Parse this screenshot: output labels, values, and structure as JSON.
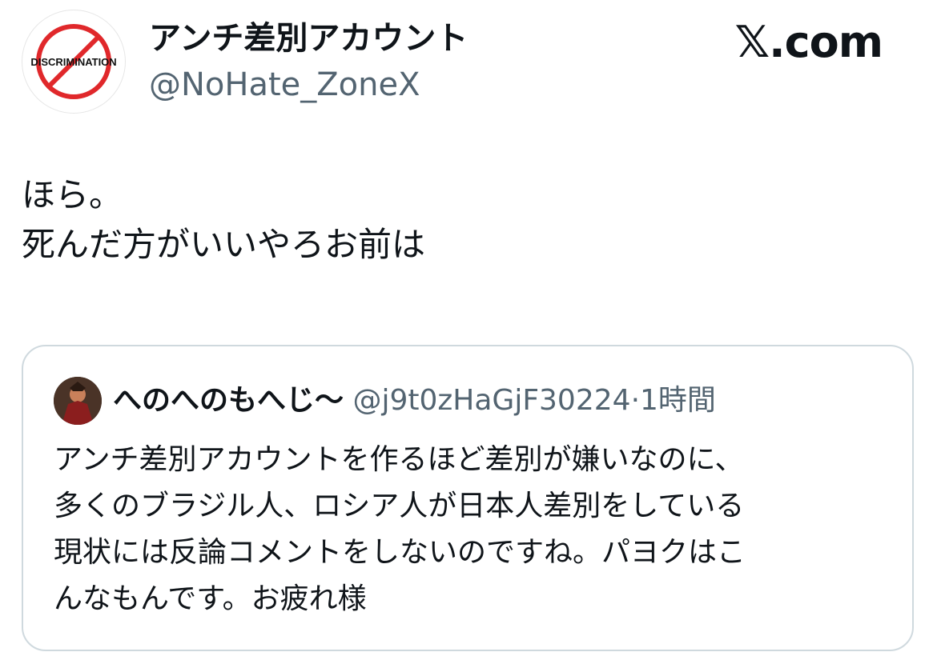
{
  "colors": {
    "text_primary": "#0f1419",
    "text_secondary": "#536471",
    "border": "#cfd9de",
    "avatar_prohibition_red": "#e0282b"
  },
  "author": {
    "avatar_icon": "discrimination-prohibited-avatar",
    "avatar_text": "DISCRIMINATION",
    "display_name": "アンチ差別アカウント",
    "handle": "@NoHate_ZoneX"
  },
  "brand": {
    "logo_icon": "x-logo-icon",
    "logo_glyph": "𝕏",
    "domain_text": ".com"
  },
  "tweet": {
    "lines": [
      "ほら。",
      "死んだ方がいいやろお前は"
    ]
  },
  "quoted_tweet": {
    "avatar_icon": "user-avatar",
    "display_name": "へのへのもへじ〜",
    "handle": "@j9t0zHaGjF30224",
    "separator": "·",
    "time": "1時間",
    "lines": [
      "アンチ差別アカウントを作るほど差別が嫌いなのに、",
      "多くのブラジル人、ロシア人が日本人差別をしている",
      "現状には反論コメントをしないのですね。パヨクはこ",
      "んなもんです。お疲れ様"
    ]
  }
}
